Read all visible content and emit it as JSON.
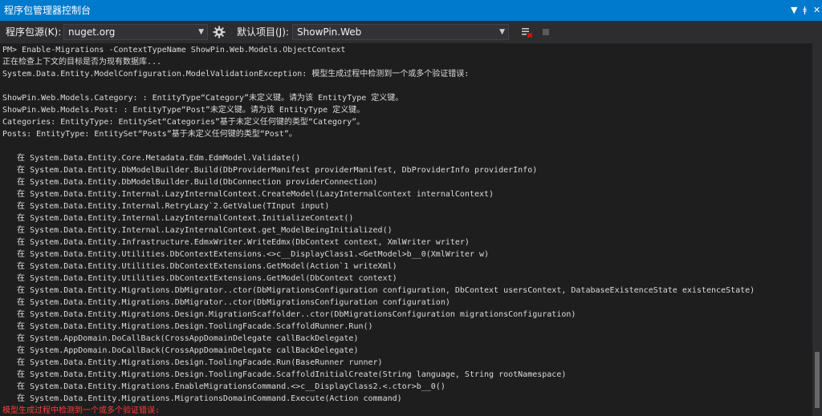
{
  "titlebar": {
    "title": "程序包管理器控制台",
    "dropdown_glyph": "▼",
    "pin_glyph": "ǂ",
    "close_glyph": "✕"
  },
  "toolbar": {
    "source_label": "程序包源(K):",
    "source_value": "nuget.org",
    "default_project_label": "默认项目(J):",
    "default_project_value": "ShowPin.Web",
    "settings_icon": "gear-icon",
    "clear_icon": "clear-console-icon",
    "stop_icon": "stop-icon"
  },
  "console": {
    "lines": [
      "PM> Enable-Migrations -ContextTypeName ShowPin.Web.Models.ObjectContext",
      "正在检查上下文的目标是否为现有数据库...",
      "System.Data.Entity.ModelConfiguration.ModelValidationException: 模型生成过程中检测到一个或多个验证错误:",
      "",
      "ShowPin.Web.Models.Category: : EntityType“Category”未定义键。请为该 EntityType 定义键。",
      "ShowPin.Web.Models.Post: : EntityType“Post”未定义键。请为该 EntityType 定义键。",
      "Categories: EntityType: EntitySet“Categories”基于未定义任何键的类型“Category”。",
      "Posts: EntityType: EntitySet“Posts”基于未定义任何键的类型“Post”。",
      "",
      "   在 System.Data.Entity.Core.Metadata.Edm.EdmModel.Validate()",
      "   在 System.Data.Entity.DbModelBuilder.Build(DbProviderManifest providerManifest, DbProviderInfo providerInfo)",
      "   在 System.Data.Entity.DbModelBuilder.Build(DbConnection providerConnection)",
      "   在 System.Data.Entity.Internal.LazyInternalContext.CreateModel(LazyInternalContext internalContext)",
      "   在 System.Data.Entity.Internal.RetryLazy`2.GetValue(TInput input)",
      "   在 System.Data.Entity.Internal.LazyInternalContext.InitializeContext()",
      "   在 System.Data.Entity.Internal.LazyInternalContext.get_ModelBeingInitialized()",
      "   在 System.Data.Entity.Infrastructure.EdmxWriter.WriteEdmx(DbContext context, XmlWriter writer)",
      "   在 System.Data.Entity.Utilities.DbContextExtensions.<>c__DisplayClass1.<GetModel>b__0(XmlWriter w)",
      "   在 System.Data.Entity.Utilities.DbContextExtensions.GetModel(Action`1 writeXml)",
      "   在 System.Data.Entity.Utilities.DbContextExtensions.GetModel(DbContext context)",
      "   在 System.Data.Entity.Migrations.DbMigrator..ctor(DbMigrationsConfiguration configuration, DbContext usersContext, DatabaseExistenceState existenceState)",
      "   在 System.Data.Entity.Migrations.DbMigrator..ctor(DbMigrationsConfiguration configuration)",
      "   在 System.Data.Entity.Migrations.Design.MigrationScaffolder..ctor(DbMigrationsConfiguration migrationsConfiguration)",
      "   在 System.Data.Entity.Migrations.Design.ToolingFacade.ScaffoldRunner.Run()",
      "   在 System.AppDomain.DoCallBack(CrossAppDomainDelegate callBackDelegate)",
      "   在 System.AppDomain.DoCallBack(CrossAppDomainDelegate callBackDelegate)",
      "   在 System.Data.Entity.Migrations.Design.ToolingFacade.Run(BaseRunner runner)",
      "   在 System.Data.Entity.Migrations.Design.ToolingFacade.ScaffoldInitialCreate(String language, String rootNamespace)",
      "   在 System.Data.Entity.Migrations.EnableMigrationsCommand.<>c__DisplayClass2.<.ctor>b__0()",
      "   在 System.Data.Entity.Migrations.MigrationsDomainCommand.Execute(Action command)"
    ],
    "error_summary": "模型生成过程中检测到一个或多个验证错误:"
  },
  "colors": {
    "titlebar": "#007acc",
    "toolbar": "#2d2d30",
    "console_bg": "#1e1e1e",
    "text": "#dcdcdc",
    "error": "#ff3c3c"
  }
}
